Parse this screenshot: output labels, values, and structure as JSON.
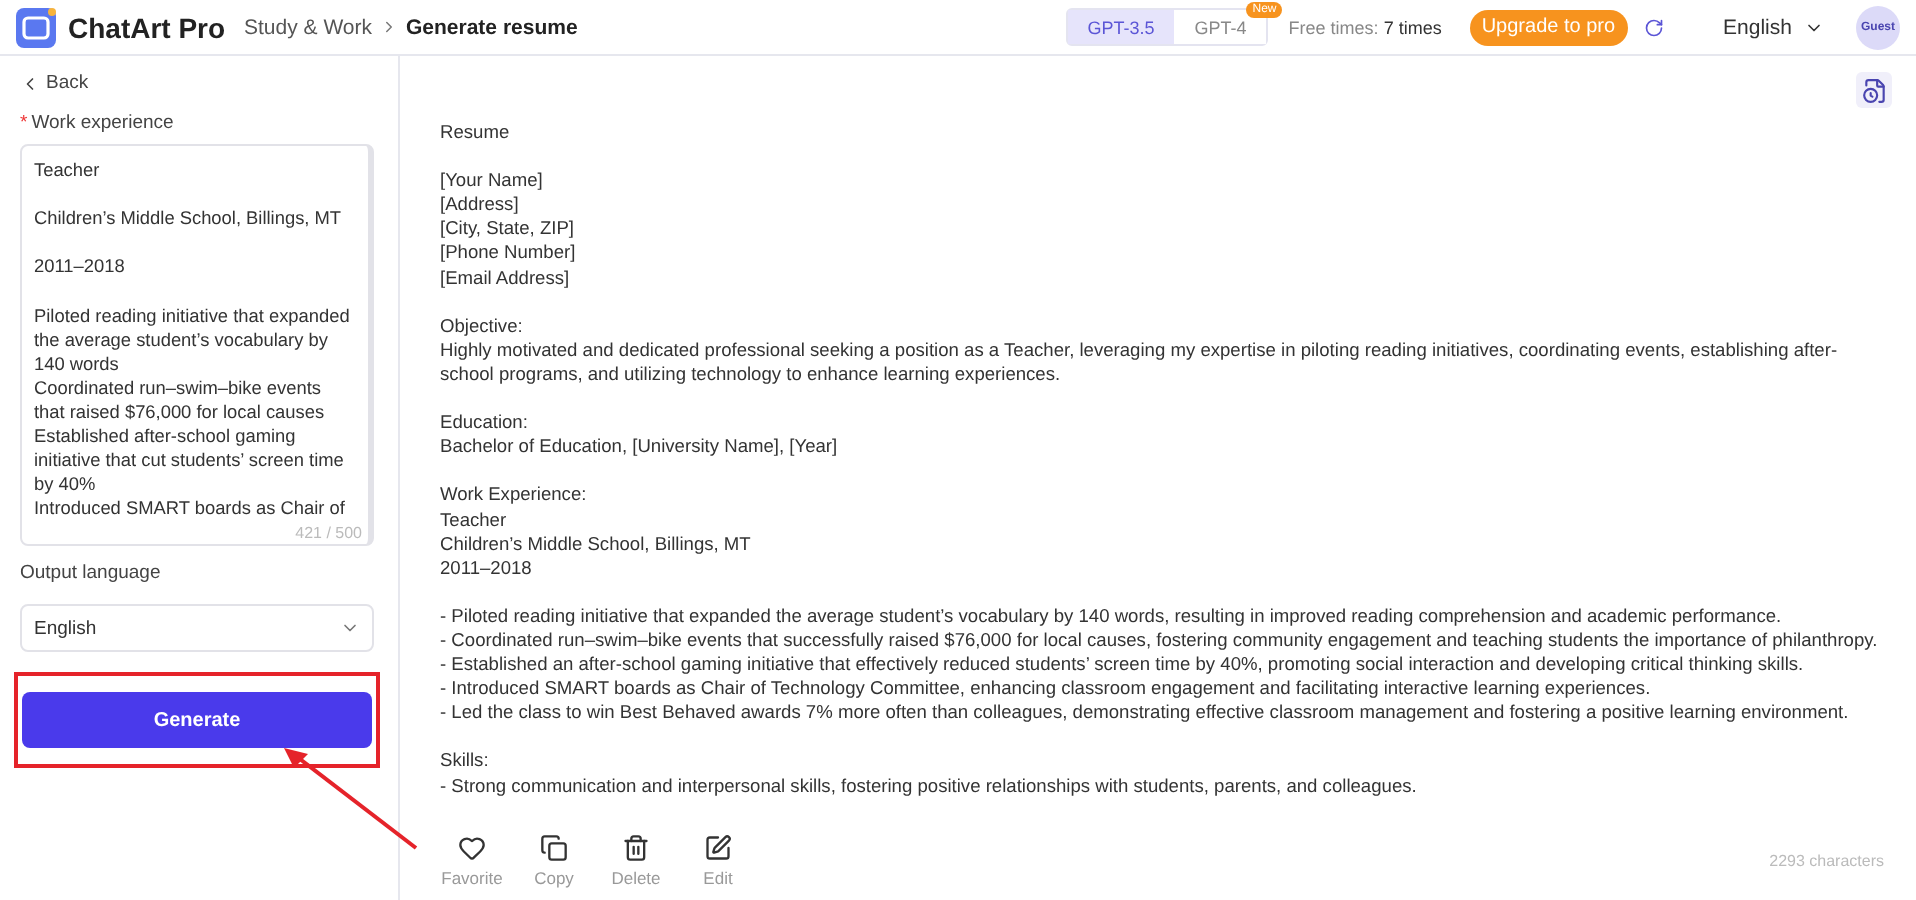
{
  "header": {
    "logo_text": "ChatArt Pro",
    "breadcrumb": [
      {
        "label": "Study & Work",
        "current": false
      },
      {
        "label": "Generate resume",
        "current": true
      }
    ],
    "model_tabs": [
      {
        "label": "GPT-3.5",
        "selected": true
      },
      {
        "label": "GPT-4",
        "selected": false,
        "badge": "New"
      }
    ],
    "free_times": {
      "label": "Free times:",
      "value": "7 times"
    },
    "upgrade_button": "Upgrade to pro",
    "language": "English",
    "avatar": "Guest"
  },
  "sidebar": {
    "back": "Back",
    "work_experience": {
      "label": "Work experience",
      "required": true,
      "required_mark": "*",
      "value": "Teacher\n\nChildren’s Middle School, Billings, MT\n\n2011–2018\n\nPiloted reading initiative that expanded the average student’s vocabulary by 140 words\nCoordinated run–swim–bike events that raised $76,000 for local causes\nEstablished after-school gaming initiative that cut students’ screen time by 40%\nIntroduced SMART boards as Chair of",
      "counter": "421 / 500"
    },
    "output_language": {
      "label": "Output language",
      "value": "English"
    },
    "generate_button": "Generate",
    "highlighted": true
  },
  "result": {
    "paragraphs": [
      [
        "Resume"
      ],
      [
        "[Your Name]",
        "[Address]",
        "[City, State, ZIP]",
        "[Phone Number]",
        "[Email Address]"
      ],
      [
        "Objective:",
        "Highly motivated and dedicated professional seeking a position as a Teacher, leveraging my expertise in piloting reading initiatives, coordinating events, establishing after-school programs, and utilizing technology to enhance learning experiences."
      ],
      [
        "Education:",
        "Bachelor of Education, [University Name], [Year]"
      ],
      [
        "Work Experience:",
        "Teacher",
        "Children’s Middle School, Billings, MT",
        "2011–2018"
      ],
      [
        "- Piloted reading initiative that expanded the average student’s vocabulary by 140 words, resulting in improved reading comprehension and academic performance.",
        "- Coordinated run–swim–bike events that successfully raised $76,000 for local causes, fostering community engagement and teaching students the importance of philanthropy.",
        "- Established an after-school gaming initiative that effectively reduced students’ screen time by 40%, promoting social interaction and developing critical thinking skills.",
        "- Introduced SMART boards as Chair of Technology Committee, enhancing classroom engagement and facilitating interactive learning experiences.",
        "- Led the class to win Best Behaved awards 7% more often than colleagues, demonstrating effective classroom management and fostering a positive learning environment."
      ],
      [
        "Skills:",
        "- Strong communication and interpersonal skills, fostering positive relationships with students, parents, and colleagues."
      ]
    ],
    "actions": [
      {
        "kind": "favorite",
        "label": "Favorite"
      },
      {
        "kind": "copy",
        "label": "Copy"
      },
      {
        "kind": "delete",
        "label": "Delete"
      },
      {
        "kind": "edit",
        "label": "Edit"
      }
    ],
    "char_count": "2293 characters"
  }
}
